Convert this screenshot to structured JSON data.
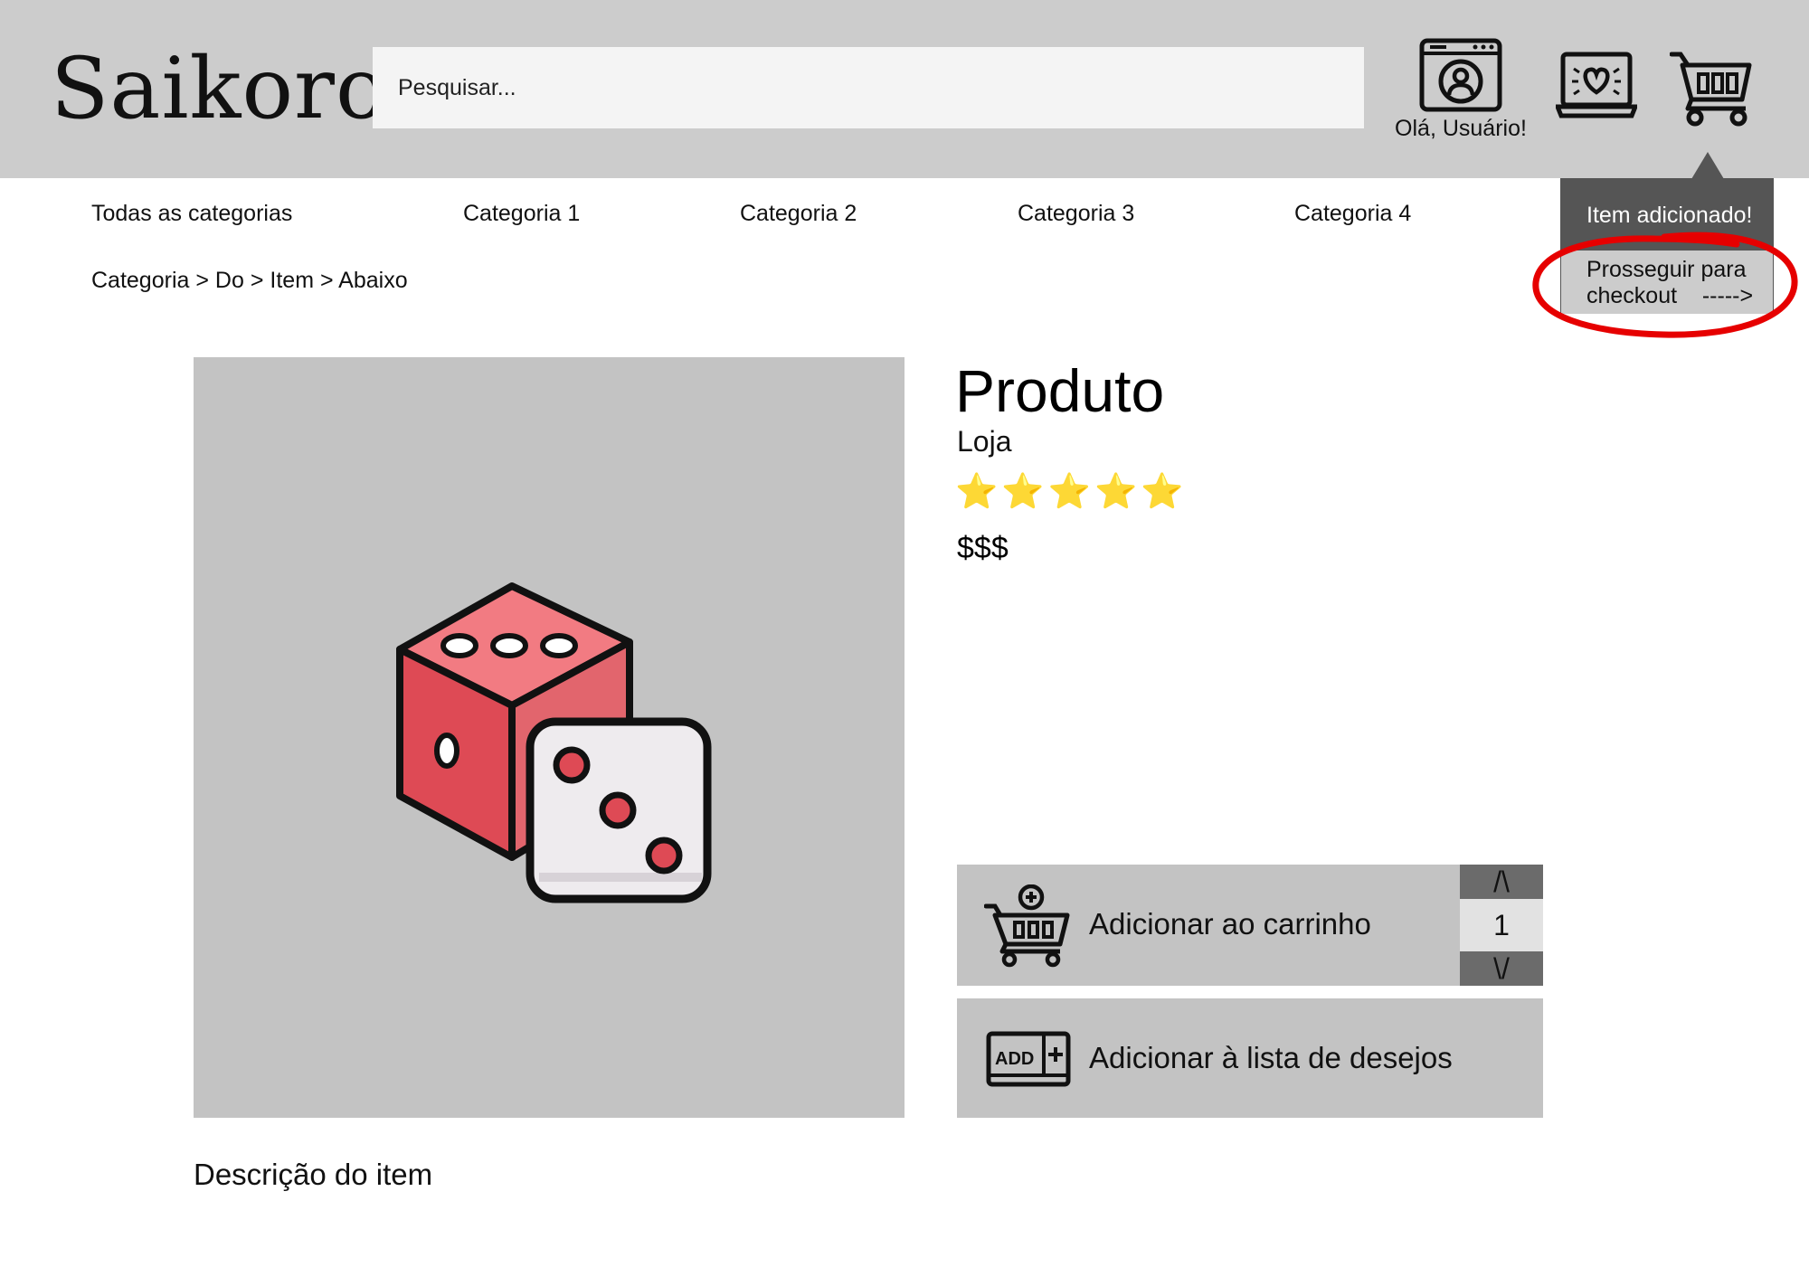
{
  "header": {
    "logo": "Saikoro",
    "search_placeholder": "Pesquisar...",
    "user_greeting": "Olá, Usuário!",
    "icons": [
      "user-account-icon",
      "wishlist-heart-icon",
      "cart-icon"
    ]
  },
  "popup": {
    "title": "Item adicionado!",
    "checkout_line1": "Prosseguir para",
    "checkout_line2": "checkout    ----->"
  },
  "nav": {
    "items": [
      "Todas as categorias",
      "Categoria 1",
      "Categoria 2",
      "Categoria 3",
      "Categoria 4"
    ]
  },
  "breadcrumb": [
    "Categoria",
    ">",
    "Do",
    ">",
    "Item",
    ">",
    "Abaixo"
  ],
  "product": {
    "title": "Produto",
    "store": "Loja",
    "rating_stars": "⭐⭐⭐⭐⭐",
    "rating_value": 5,
    "rating_max": 5,
    "price": "$$$",
    "image_icon": "dice-icon",
    "add_to_cart_label": "Adicionar ao carrinho",
    "add_to_wishlist_label": "Adicionar à lista de desejos",
    "quantity": "1",
    "qty_up_label": "/\\",
    "qty_down_label": "\\/",
    "description": "Descrição do item"
  },
  "colors": {
    "header_bg": "#cccccc",
    "popup_bg": "#555555",
    "highlight": "#e60000",
    "image_bg": "#c3c3c3",
    "button_bg": "#c3c3c3",
    "dice_red": "#de4a55"
  }
}
